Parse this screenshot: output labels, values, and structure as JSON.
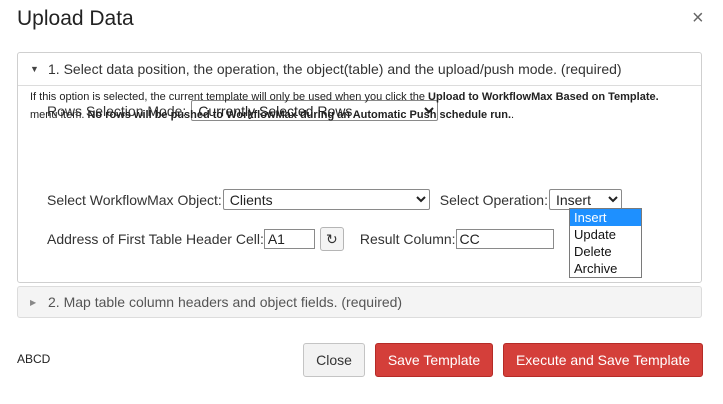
{
  "dialog": {
    "title": "Upload Data",
    "close_glyph": "×"
  },
  "section1": {
    "header": "1. Select data position, the operation, the object(table) and the upload/push mode. (required)",
    "expanded_glyph": "▼",
    "rows_selection_label": "Rows Selection Mode:",
    "rows_selection_value": "Currently Selected Rows",
    "note": {
      "part1": "If this option is selected, the current template will only be used when you click the ",
      "bold1": "Upload to WorkflowMax Based on Template.",
      "part2": " menu item. ",
      "bold2": "No rows will be pushed to WorkflowMax during an Automatic Push schedule run.",
      "part3": "."
    },
    "object_label": "Select WorkflowMax Object:",
    "object_value": "Clients",
    "operation_label": "Select Operation:",
    "operation_value": "Insert",
    "operation_options": [
      "Insert",
      "Update",
      "Delete",
      "Archive"
    ],
    "address_label": "Address of First Table Header Cell:",
    "address_value": "A1",
    "refresh_icon": "↻",
    "result_label": "Result Column:",
    "result_value": "CC"
  },
  "section2": {
    "header": "2. Map table column headers and object fields. (required)",
    "collapsed_glyph": "▶"
  },
  "footer": {
    "text": "ABCD",
    "close_label": "Close",
    "save_label": "Save Template",
    "execute_label": "Execute and Save Template"
  },
  "colors": {
    "primary_red": "#d43f3a",
    "highlight_blue": "#1e90ff"
  }
}
